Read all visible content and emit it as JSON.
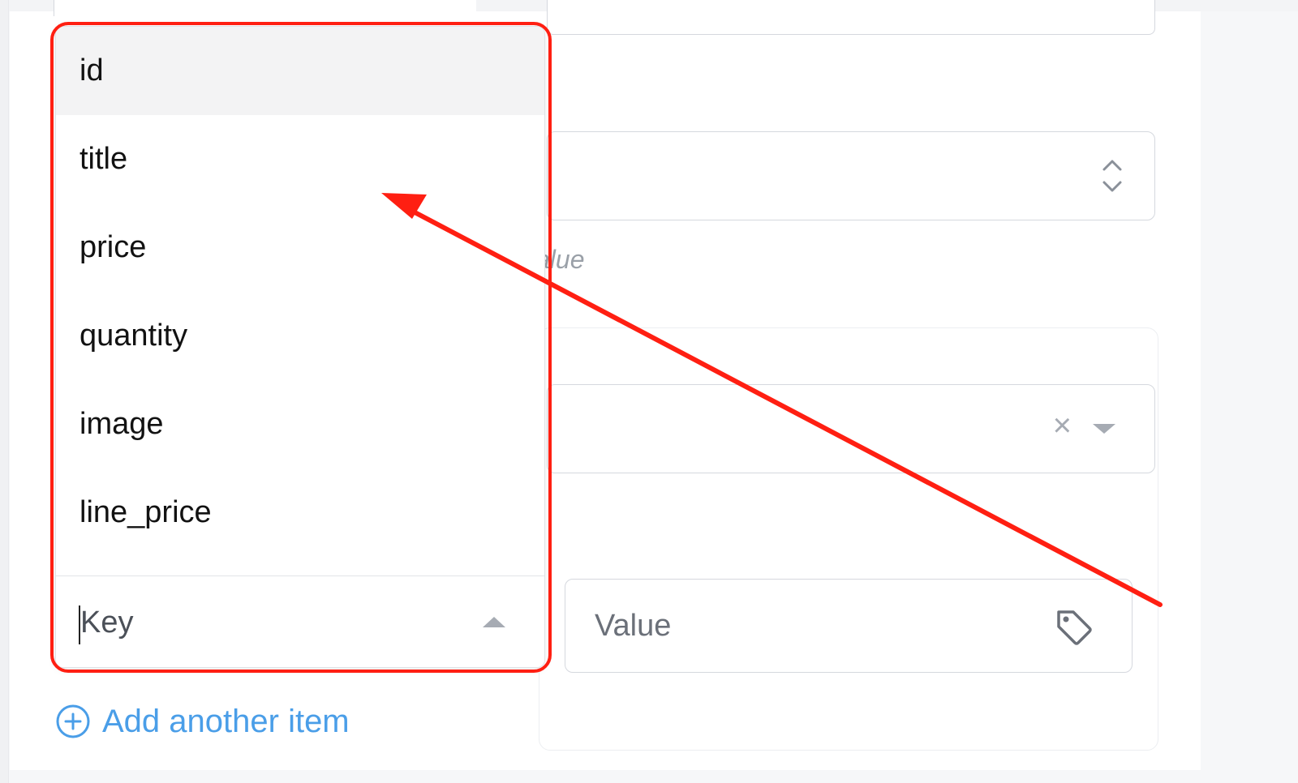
{
  "dropdown": {
    "options": [
      {
        "label": "id"
      },
      {
        "label": "title"
      },
      {
        "label": "price"
      },
      {
        "label": "quantity"
      },
      {
        "label": "image"
      },
      {
        "label": "line_price"
      }
    ],
    "highlighted_option": "id",
    "key_placeholder": "Key"
  },
  "value_field": {
    "placeholder": "Value"
  },
  "hint": {
    "visible_fragment": "alue"
  },
  "actions": {
    "add_item_label": "Add another item"
  },
  "colors": {
    "annotation_red": "#ff1f12",
    "link_blue": "#4a9ee8",
    "border_gray": "#d5d8de"
  },
  "icons": {
    "value_field": "tag-icon",
    "add_item": "plus-circle-icon",
    "select": "up-down-chevron-icon",
    "combo_clear": "close-icon",
    "combo_toggle": "caret-down-icon",
    "key_toggle": "caret-up-icon"
  }
}
